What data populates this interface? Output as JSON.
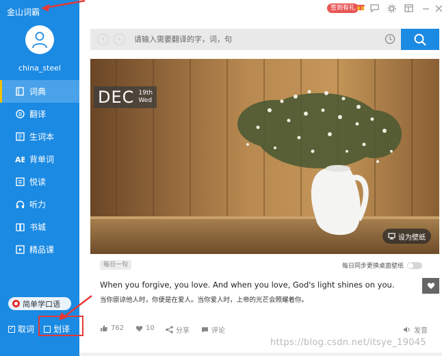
{
  "sidebar": {
    "app_title": "金山词霸",
    "username": "china_steel",
    "items": [
      {
        "label": "词典",
        "icon": "dictionary-icon",
        "active": true
      },
      {
        "label": "翻译",
        "icon": "translate-icon"
      },
      {
        "label": "生词本",
        "icon": "wordbook-icon"
      },
      {
        "label": "背单词",
        "icon": "recite-words-icon"
      },
      {
        "label": "悦读",
        "icon": "reading-icon"
      },
      {
        "label": "听力",
        "icon": "headphones-icon"
      },
      {
        "label": "书城",
        "icon": "bookstore-icon"
      },
      {
        "label": "精品课",
        "icon": "course-play-icon"
      }
    ],
    "simple_speaking": "简单学口语",
    "check_cancel": "取词",
    "check_huayi": "划译"
  },
  "topbar": {
    "signin_badge": "签到有礼"
  },
  "search": {
    "placeholder": "请输入需要翻译的字，词，句"
  },
  "hero": {
    "month": "DEC",
    "day": "19th",
    "weekday": "Wed",
    "wallpaper_button": "设为壁纸"
  },
  "daily": {
    "tag": "每日一句",
    "sync_label": "每日同步更换桌面壁纸",
    "quote_en": "When you forgive, you love. And when you love, God's light shines on you.",
    "quote_zh": "当你原谅他人时，你便是在爱人。当你爱人时，上帝的光芒会照耀着你。",
    "likes": "762",
    "favorites": "10",
    "share": "分享",
    "comment": "评论",
    "pronounce": "发音"
  },
  "watermark": "https://blog.csdn.net/itsye_19045",
  "colors": {
    "sidebar": "#1b8ae3",
    "active_indicator": "#f5c000",
    "annotation_red": "#e53935"
  }
}
